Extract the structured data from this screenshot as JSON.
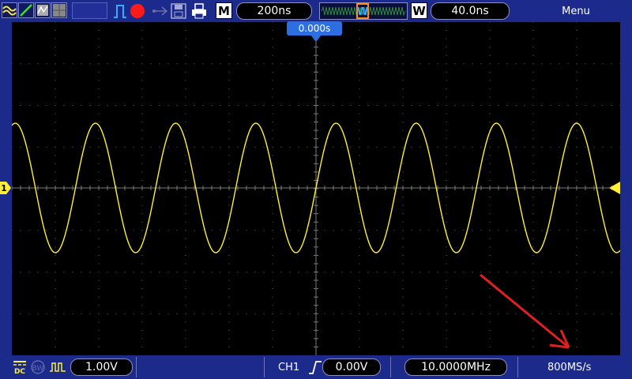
{
  "top": {
    "menu_label": "Menu",
    "mode_label": "M",
    "timebase": "200ns",
    "window_label": "W",
    "window_timebase": "40.0ns",
    "trigger_position": "0.000s"
  },
  "bottom": {
    "coupling": "DC",
    "ch1_scale": "1.00V",
    "trigger_source": "CH1",
    "trigger_level": "0.00V",
    "frequency": "10.0000MHz",
    "sample_rate": "800MS/s"
  },
  "channel": {
    "marker": "1"
  },
  "colors": {
    "trace": "#ffef3a",
    "background": "#1c2a8c",
    "screen": "#000000",
    "arrow": "#e02020",
    "accent": "#2d6fe0"
  }
}
